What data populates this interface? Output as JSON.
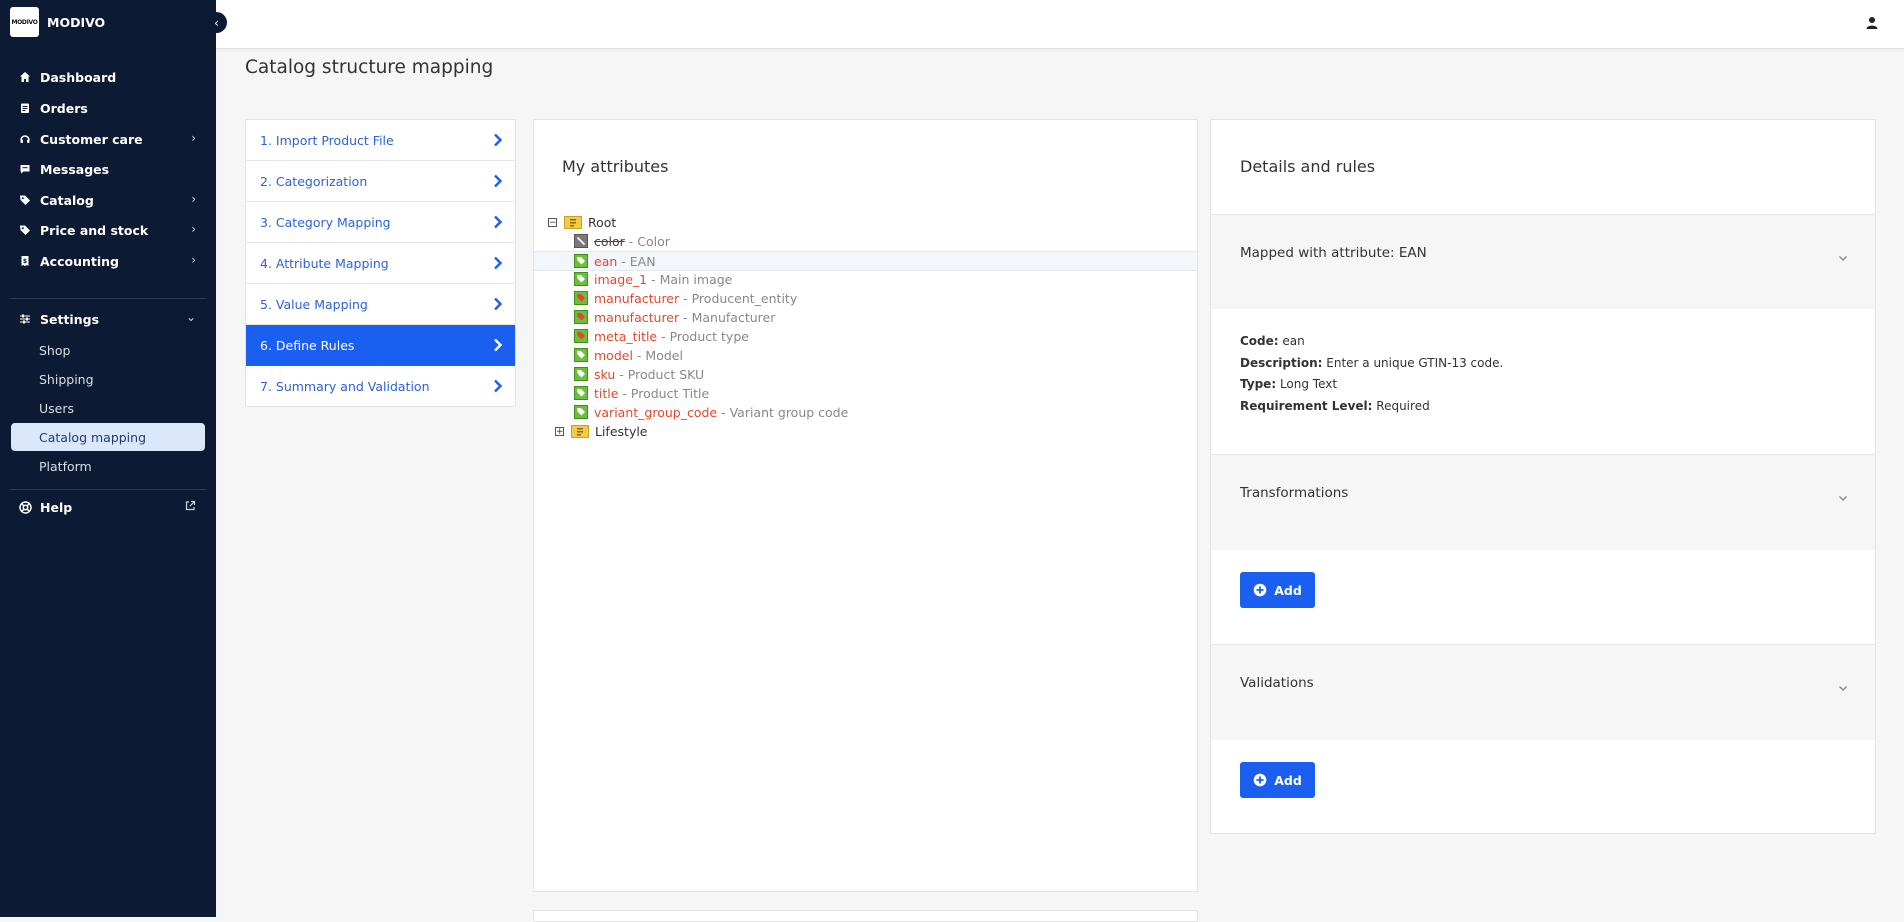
{
  "brand": {
    "logo_text": "MODIVO",
    "name": "MODIVO"
  },
  "sidebar": {
    "items": [
      {
        "label": "Dashboard",
        "icon": "home-icon"
      },
      {
        "label": "Orders",
        "icon": "clipboard-icon"
      },
      {
        "label": "Customer care",
        "icon": "headset-icon"
      },
      {
        "label": "Messages",
        "icon": "message-icon"
      },
      {
        "label": "Catalog",
        "icon": "tag-icon"
      },
      {
        "label": "Price and stock",
        "icon": "price-tag-icon"
      },
      {
        "label": "Accounting",
        "icon": "receipt-icon"
      }
    ],
    "settings": {
      "label": "Settings",
      "subitems": [
        "Shop",
        "Shipping",
        "Users",
        "Catalog mapping",
        "Platform"
      ],
      "active": "Catalog mapping"
    },
    "help": {
      "label": "Help"
    }
  },
  "page_title": "Catalog structure mapping",
  "steps": [
    "1. Import Product File",
    "2. Categorization",
    "3. Category Mapping",
    "4. Attribute Mapping",
    "5. Value Mapping",
    "6. Define Rules",
    "7. Summary and Validation"
  ],
  "active_step": "6. Define Rules",
  "attributes": {
    "title": "My attributes",
    "root_label": "Root",
    "items": [
      {
        "code": "color",
        "desc": "- Color",
        "disabled": true
      },
      {
        "code": "ean",
        "desc": "- EAN",
        "selected": true
      },
      {
        "code": "image_1",
        "desc": "- Main image"
      },
      {
        "code": "manufacturer",
        "desc": "- Producent_entity"
      },
      {
        "code": "manufacturer",
        "desc": "- Manufacturer"
      },
      {
        "code": "meta_title",
        "desc": "- Product type"
      },
      {
        "code": "model",
        "desc": "- Model"
      },
      {
        "code": "sku",
        "desc": "- Product SKU"
      },
      {
        "code": "title",
        "desc": "- Product Title"
      },
      {
        "code": "variant_group_code",
        "desc": "- Variant group code"
      }
    ],
    "group_label": "Lifestyle"
  },
  "details": {
    "title": "Details and rules",
    "mapped_label": "Mapped with attribute: EAN",
    "code_label": "Code:",
    "code_value": "ean",
    "description_label": "Description:",
    "description_value": "Enter a unique GTIN-13 code.",
    "type_label": "Type:",
    "type_value": "Long Text",
    "requirement_label": "Requirement Level:",
    "requirement_value": "Required",
    "transformations_label": "Transformations",
    "validations_label": "Validations",
    "add_label": "Add"
  },
  "colors": {
    "sidebar_bg": "#0c1b33",
    "accent": "#1a5ff0",
    "attr_code": "#e0492f",
    "active_sub_bg": "#dbe7fb"
  }
}
